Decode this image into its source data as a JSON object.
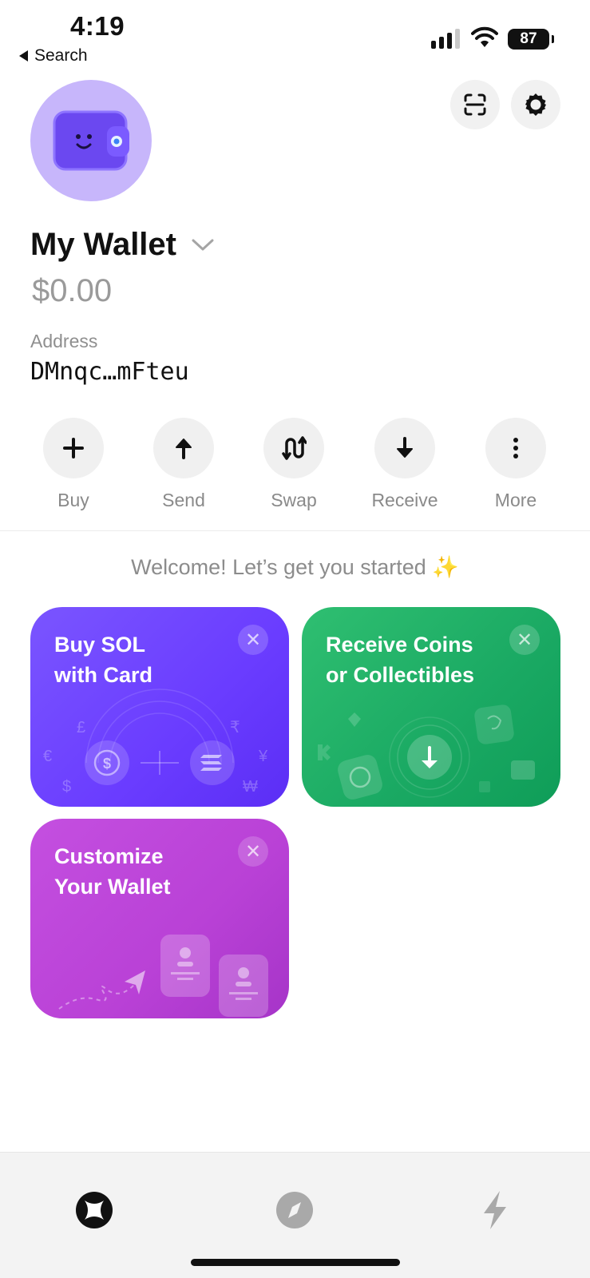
{
  "status_bar": {
    "time": "4:19",
    "back_label": "Search",
    "battery": "87"
  },
  "header": {
    "wallet_name": "My Wallet",
    "balance": "$0.00",
    "address_label": "Address",
    "address_value": "DMnqc…mFteu"
  },
  "actions": [
    {
      "label": "Buy",
      "icon": "plus-icon"
    },
    {
      "label": "Send",
      "icon": "arrow-up-icon"
    },
    {
      "label": "Swap",
      "icon": "swap-icon"
    },
    {
      "label": "Receive",
      "icon": "arrow-down-icon"
    },
    {
      "label": "More",
      "icon": "vertical-dots-icon"
    }
  ],
  "welcome": {
    "text": "Welcome! Let’s get you started",
    "emoji": "✨"
  },
  "cards": {
    "buy": {
      "title": "Buy SOL\nwith Card",
      "close": "✕",
      "currency_symbols": [
        "£",
        "₹",
        "€",
        "¥",
        "$",
        "₩"
      ]
    },
    "receive": {
      "title": "Receive Coins\nor Collectibles",
      "close": "✕"
    },
    "customize": {
      "title": "Customize\nYour Wallet",
      "close": "✕"
    }
  },
  "colors": {
    "accent_purple": "#6a3cff",
    "green": "#1aa963",
    "magenta": "#b941d6",
    "muted_text": "#8c8c8c"
  },
  "tabs": [
    {
      "name": "home",
      "icon": "wallet-home-icon",
      "active": true
    },
    {
      "name": "explore",
      "icon": "compass-icon",
      "active": false
    },
    {
      "name": "activity",
      "icon": "lightning-icon",
      "active": false
    }
  ]
}
